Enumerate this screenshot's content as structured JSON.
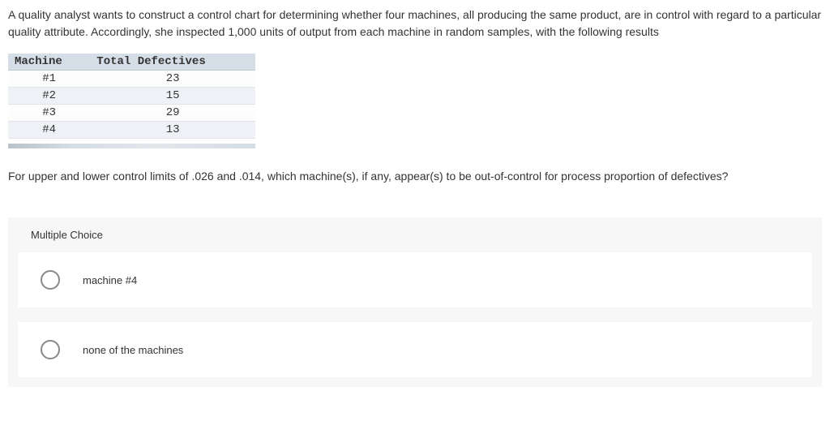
{
  "intro": "A quality analyst wants to construct a control chart for determining whether four machines, all producing the same product, are in control with regard to a particular quality attribute. Accordingly, she inspected 1,000 units of output from each machine in random samples, with the following results",
  "table": {
    "headers": {
      "machine": "Machine",
      "defectives": "Total Defectives"
    },
    "rows": [
      {
        "machine": "#1",
        "defectives": "23"
      },
      {
        "machine": "#2",
        "defectives": "15"
      },
      {
        "machine": "#3",
        "defectives": "29"
      },
      {
        "machine": "#4",
        "defectives": "13"
      }
    ]
  },
  "question": "For upper and lower control limits of .026 and .014, which machine(s), if any, appear(s) to be out-of-control for process proportion of defectives?",
  "mc": {
    "heading": "Multiple Choice",
    "options": [
      {
        "label": "machine #4"
      },
      {
        "label": "none of the machines"
      }
    ]
  }
}
